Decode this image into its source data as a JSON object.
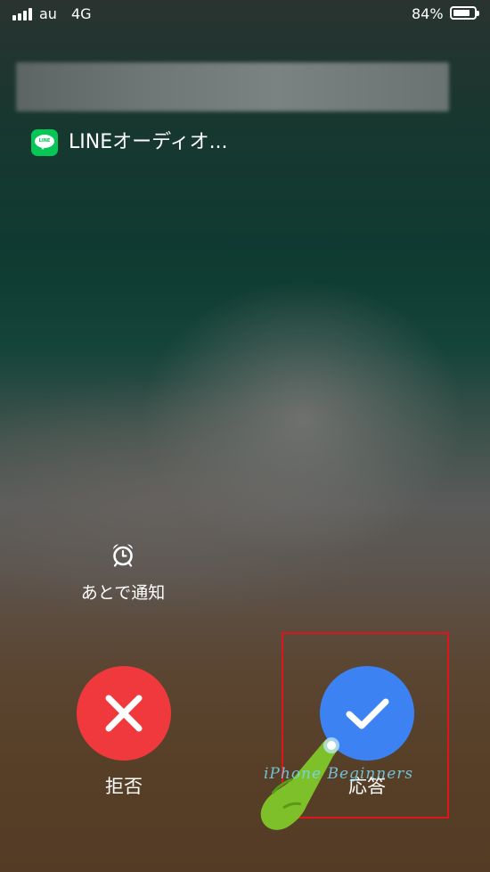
{
  "status_bar": {
    "carrier": "au",
    "network": "4G",
    "battery_percent": "84%",
    "battery_level": 0.84,
    "signal_bars": 4
  },
  "notification": {
    "app_name": "LINEオーディオ..."
  },
  "app_icon": {
    "name": "line-icon",
    "text": "LINE",
    "color": "#06c755"
  },
  "remind_me": {
    "icon": "alarm-clock-icon",
    "label": "あとで通知"
  },
  "decline": {
    "label": "拒否",
    "icon": "x-icon",
    "color": "#f0393d"
  },
  "accept": {
    "label": "応答",
    "icon": "checkmark-icon",
    "color": "#3d82f2"
  },
  "annotation": {
    "watermark": "iPhone Beginners",
    "highlight_color": "#e0141b"
  }
}
